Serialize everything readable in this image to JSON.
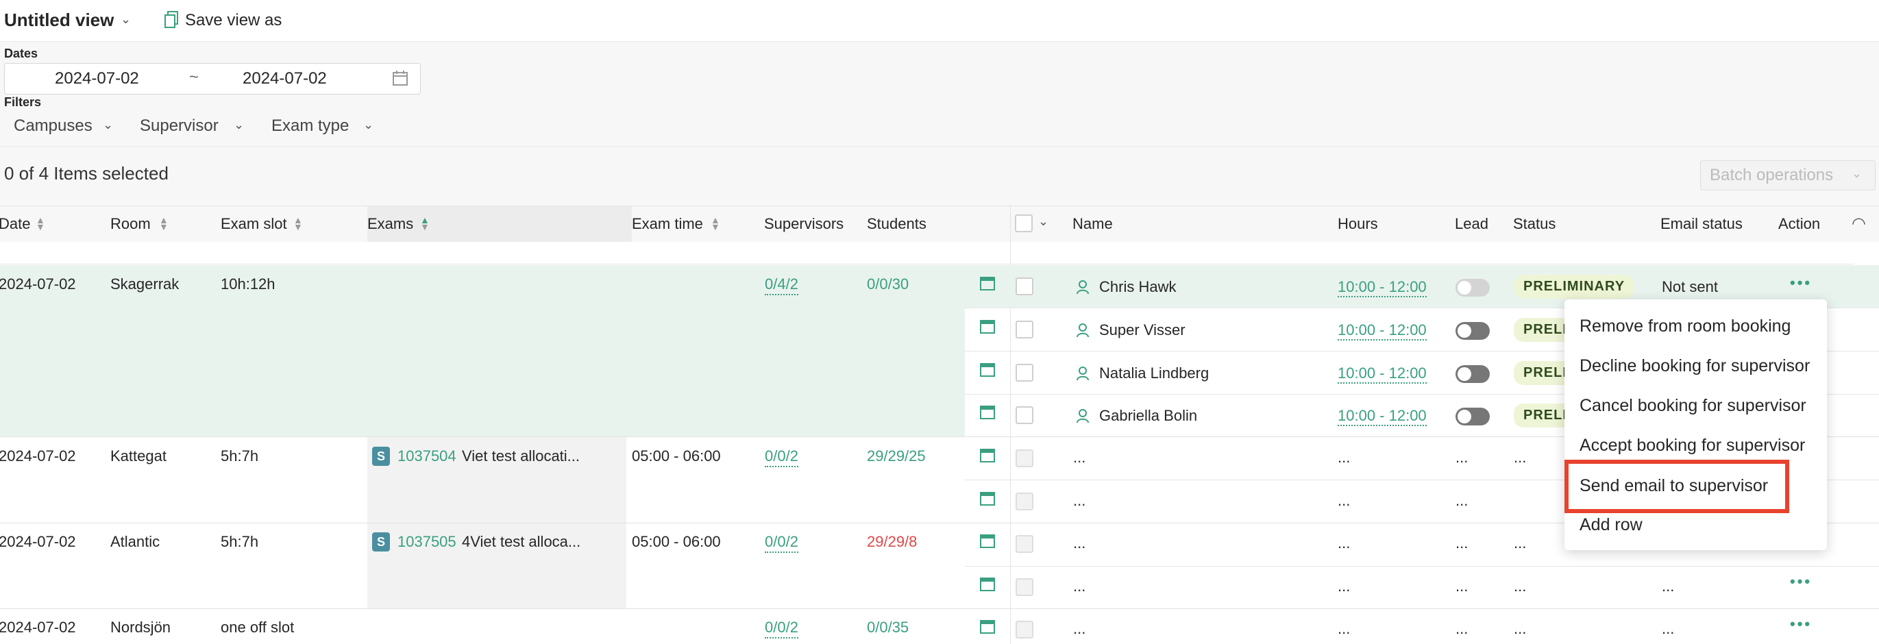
{
  "header": {
    "view_title": "Untitled view",
    "save_view_label": "Save view as"
  },
  "filters": {
    "dates_label": "Dates",
    "date_from": "2024-07-02",
    "date_separator": "~",
    "date_to": "2024-07-02",
    "filters_label": "Filters",
    "campuses": "Campuses",
    "supervisor": "Supervisor",
    "exam_type": "Exam type"
  },
  "selection": {
    "summary": "0 of 4 Items selected",
    "batch_label": "Batch operations"
  },
  "columns": {
    "date": "Date",
    "room": "Room",
    "exam_slot": "Exam slot",
    "exams": "Exams",
    "exam_time": "Exam time",
    "supervisors": "Supervisors",
    "students": "Students",
    "name": "Name",
    "hours": "Hours",
    "lead": "Lead",
    "status": "Status",
    "email_status": "Email status",
    "action": "Action"
  },
  "rooms": [
    {
      "date": "2024-07-02",
      "room": "Skagerrak",
      "slot": "10h:12h",
      "exam_code": "",
      "exam_title": "",
      "exam_time": "",
      "supervisors": "0/4/2",
      "students": "0/0/30"
    },
    {
      "date": "2024-07-02",
      "room": "Kattegat",
      "slot": "5h:7h",
      "exam_badge": "S",
      "exam_code": "1037504",
      "exam_title": "Viet test allocati...",
      "exam_time": "05:00 - 06:00",
      "supervisors": "0/0/2",
      "students": "29/29/25"
    },
    {
      "date": "2024-07-02",
      "room": "Atlantic",
      "slot": "5h:7h",
      "exam_badge": "S",
      "exam_code": "1037505",
      "exam_title": "4Viet test alloca...",
      "exam_time": "05:00 - 06:00",
      "supervisors": "0/0/2",
      "students": "29/29/8"
    },
    {
      "date": "2024-07-02",
      "room": "Nordsjön",
      "slot": "one off slot",
      "exam_code": "",
      "exam_title": "",
      "exam_time": "",
      "supervisors": "0/0/2",
      "students": "0/0/35"
    }
  ],
  "supervisor_rows": [
    {
      "name": "Chris Hawk",
      "hours": "10:00 - 12:00",
      "status": "PRELIMINARY",
      "email_status": "Not sent"
    },
    {
      "name": "Super Visser",
      "hours": "10:00 - 12:00",
      "status": "PRELI"
    },
    {
      "name": "Natalia Lindberg",
      "hours": "10:00 - 12:00",
      "status": "PRELI"
    },
    {
      "name": "Gabriella Bolin",
      "hours": "10:00 - 12:00",
      "status": "PRELI"
    }
  ],
  "placeholder": "...",
  "action_icon": "•••",
  "context_menu": [
    "Remove from room booking",
    "Decline booking for supervisor",
    "Cancel booking for supervisor",
    "Accept booking for supervisor",
    "Send email to supervisor",
    "Add row"
  ],
  "colors": {
    "accent": "#3a9f80",
    "highlight_row": "#e9f3ee",
    "alert": "#e04848",
    "focus_box": "#e8432e"
  }
}
